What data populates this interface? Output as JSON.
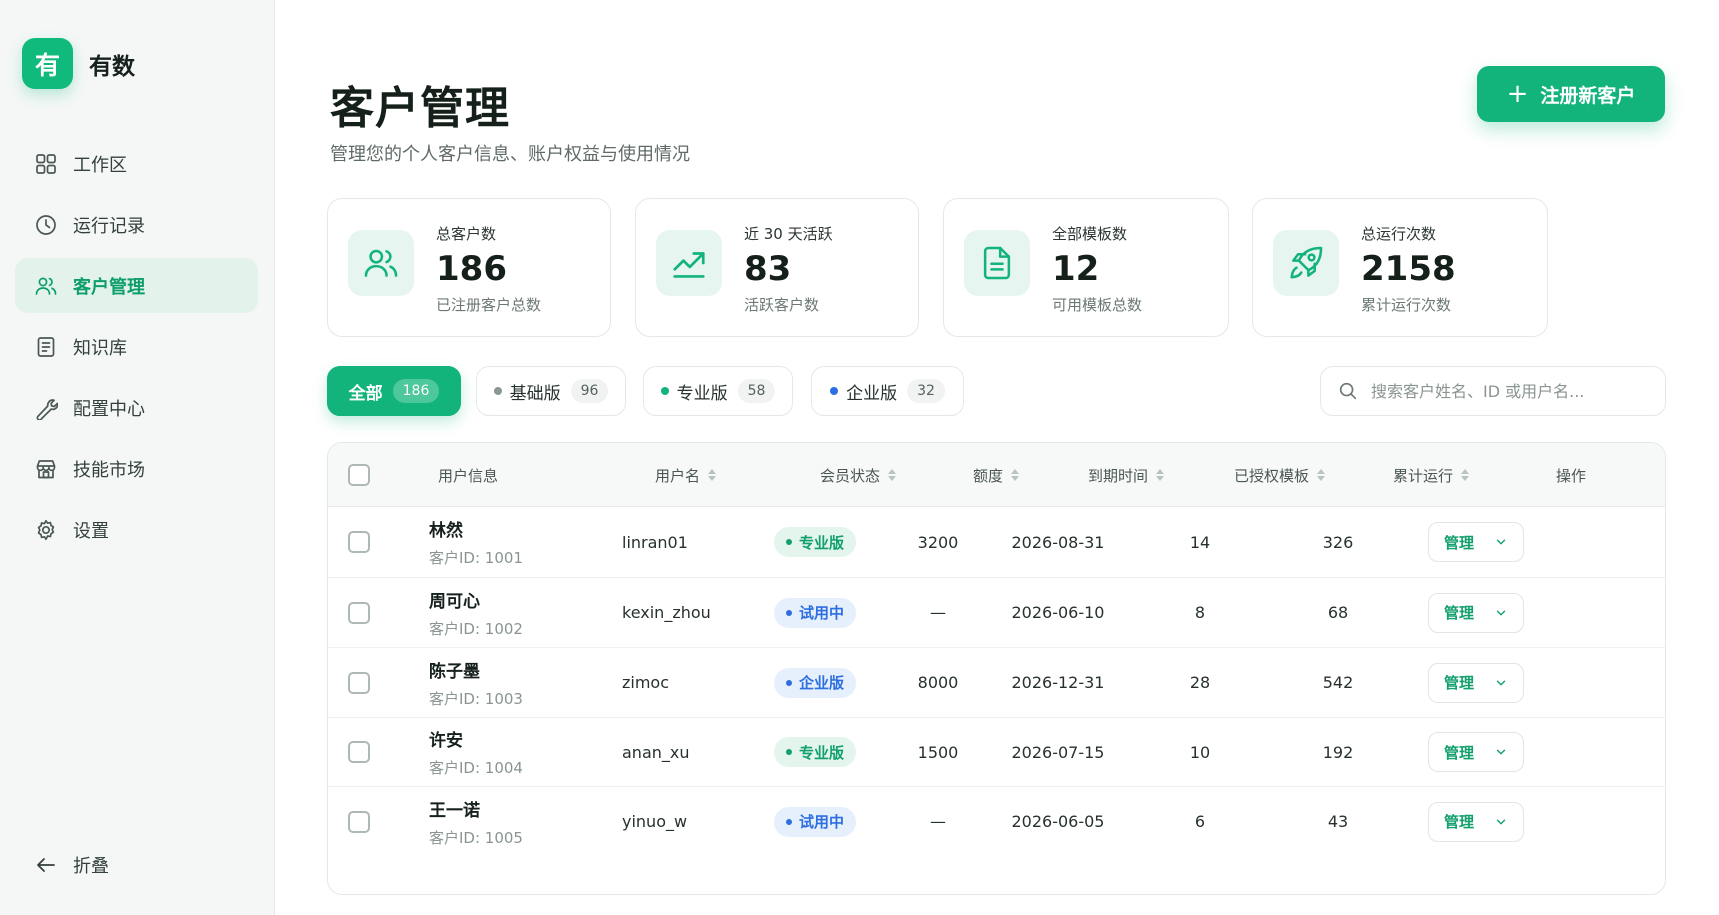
{
  "brand": {
    "logo_char": "有",
    "name": "有数"
  },
  "sidebar": {
    "items": [
      {
        "label": "工作区",
        "icon": "grid-icon",
        "active": false
      },
      {
        "label": "运行记录",
        "icon": "clock-icon",
        "active": false
      },
      {
        "label": "客户管理",
        "icon": "users-icon",
        "active": true
      },
      {
        "label": "知识库",
        "icon": "book-icon",
        "active": false
      },
      {
        "label": "配置中心",
        "icon": "wrench-icon",
        "active": false
      },
      {
        "label": "技能市场",
        "icon": "store-icon",
        "active": false
      },
      {
        "label": "设置",
        "icon": "gear-icon",
        "active": false
      }
    ],
    "collapse_label": "折叠"
  },
  "header": {
    "title": "客户管理",
    "subtitle": "管理您的个人客户信息、账户权益与使用情况",
    "register_button": "注册新客户"
  },
  "stats": [
    {
      "label": "总客户数",
      "value": "186",
      "desc": "已注册客户总数",
      "icon": "users-icon"
    },
    {
      "label": "近 30 天活跃",
      "value": "83",
      "desc": "活跃客户数",
      "icon": "trend-up-icon"
    },
    {
      "label": "全部模板数",
      "value": "12",
      "desc": "可用模板总数",
      "icon": "document-icon"
    },
    {
      "label": "总运行次数",
      "value": "2158",
      "desc": "累计运行次数",
      "icon": "rocket-icon"
    }
  ],
  "filters": {
    "tabs": [
      {
        "label": "全部",
        "count": "186",
        "active": true,
        "dot_color": ""
      },
      {
        "label": "基础版",
        "count": "96",
        "active": false,
        "dot_color": "#8a9894"
      },
      {
        "label": "专业版",
        "count": "58",
        "active": false,
        "dot_color": "#13b47b"
      },
      {
        "label": "企业版",
        "count": "32",
        "active": false,
        "dot_color": "#2d6fe0"
      }
    ],
    "search_placeholder": "搜索客户姓名、ID 或用户名..."
  },
  "table": {
    "columns": [
      "用户信息",
      "用户名",
      "会员状态",
      "额度",
      "到期时间",
      "已授权模板",
      "累计运行",
      "操作"
    ],
    "rows": [
      {
        "name": "林然",
        "customer_id": "客户ID: 1001",
        "username": "linran01",
        "status": "专业版",
        "status_color": "green",
        "quota": "3200",
        "expiry": "2026-08-31",
        "templates": "14",
        "runs": "326",
        "action": "管理"
      },
      {
        "name": "周可心",
        "customer_id": "客户ID: 1002",
        "username": "kexin_zhou",
        "status": "试用中",
        "status_color": "blue",
        "quota": "—",
        "expiry": "2026-06-10",
        "templates": "8",
        "runs": "68",
        "action": "管理"
      },
      {
        "name": "陈子墨",
        "customer_id": "客户ID: 1003",
        "username": "zimoc",
        "status": "企业版",
        "status_color": "blue",
        "quota": "8000",
        "expiry": "2026-12-31",
        "templates": "28",
        "runs": "542",
        "action": "管理"
      },
      {
        "name": "许安",
        "customer_id": "客户ID: 1004",
        "username": "anan_xu",
        "status": "专业版",
        "status_color": "green",
        "quota": "1500",
        "expiry": "2026-07-15",
        "templates": "10",
        "runs": "192",
        "action": "管理"
      },
      {
        "name": "王一诺",
        "customer_id": "客户ID: 1005",
        "username": "yinuo_w",
        "status": "试用中",
        "status_color": "blue",
        "quota": "—",
        "expiry": "2026-06-05",
        "templates": "6",
        "runs": "43",
        "action": "管理"
      }
    ]
  },
  "colors": {
    "accent": "#12b47b",
    "accent_soft": "#e3f3ec",
    "blue": "#2d6fe0"
  }
}
